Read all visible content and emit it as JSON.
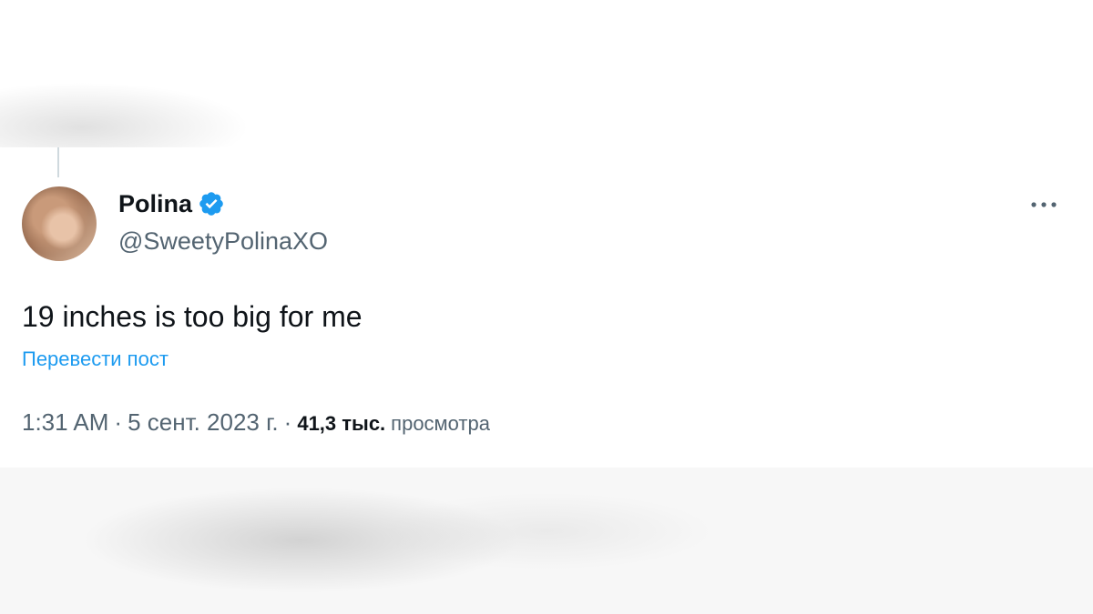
{
  "tweet": {
    "display_name": "Polina",
    "handle": "@SweetyPolinaXO",
    "text": "19 inches is too big for me",
    "translate_label": "Перевести пост",
    "time": "1:31 AM",
    "separator": "·",
    "date": "5 сент. 2023 г.",
    "views_count": "41,3 тыс.",
    "views_label": "просмотра",
    "verified_icon": "verified-badge-icon",
    "more_icon": "more-options-icon"
  },
  "colors": {
    "accent": "#1d9bf0",
    "text_primary": "#0f1419",
    "text_secondary": "#536471",
    "thread_line": "#cfd9de"
  }
}
